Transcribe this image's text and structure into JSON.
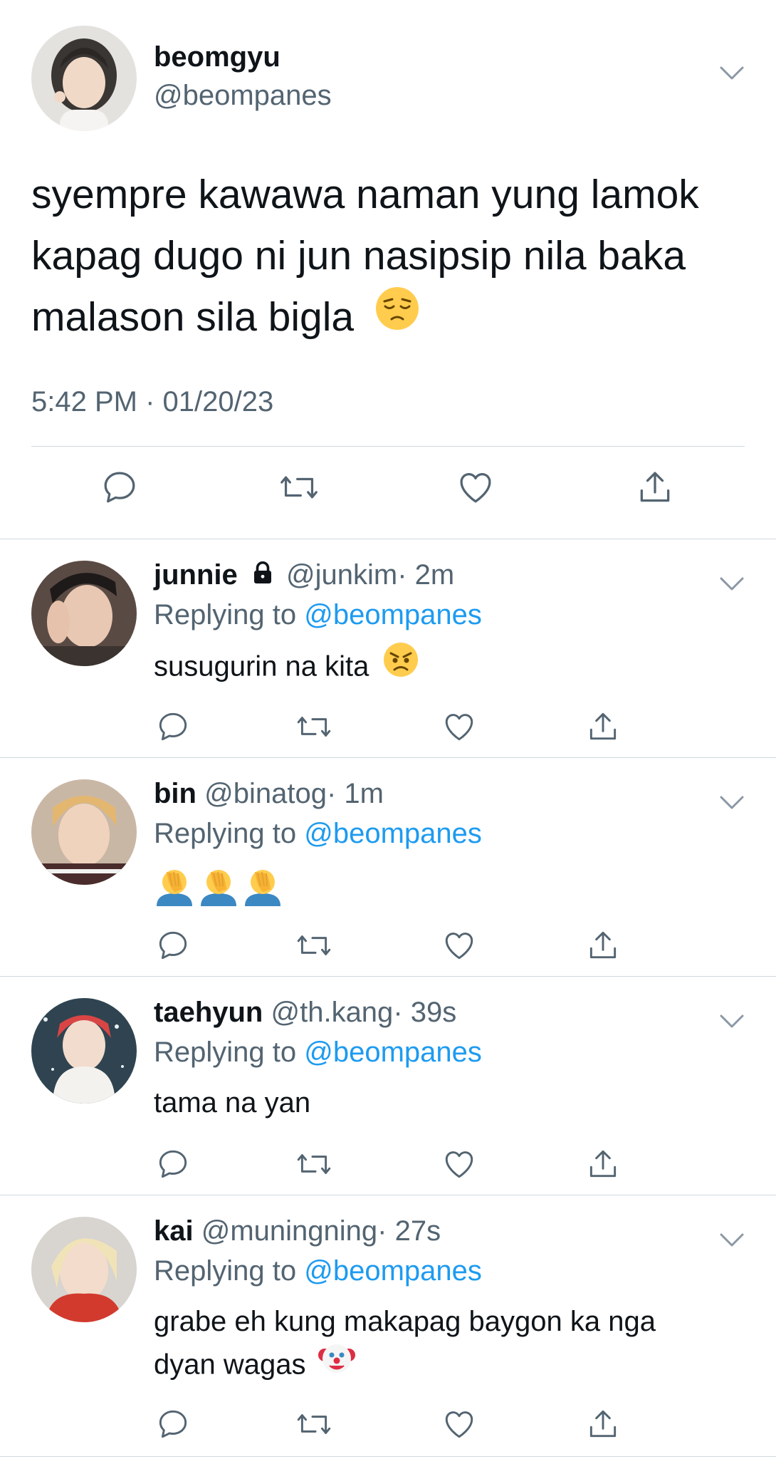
{
  "main_tweet": {
    "name": "beomgyu",
    "handle": "@beompanes",
    "text_line1": "syempre kawawa naman yung lamok",
    "text_line2": "kapag dugo ni jun nasipsip nila baka",
    "text_line3": "malason sila bigla",
    "timestamp": "5:42 PM · 01/20/23"
  },
  "replying_prefix": "Replying to",
  "replies": [
    {
      "name": "junnie",
      "handle": "@junkim",
      "time": "· 2m",
      "replying_to": "@beompanes",
      "text": "susugurin na kita"
    },
    {
      "name": "bin",
      "handle": "@binatog",
      "time": "· 1m",
      "replying_to": "@beompanes",
      "text": ""
    },
    {
      "name": "taehyun",
      "handle": "@th.kang",
      "time": "· 39s",
      "replying_to": "@beompanes",
      "text": "tama na yan"
    },
    {
      "name": "kai",
      "handle": "@muningning",
      "time": "· 27s",
      "replying_to": "@beompanes",
      "text_line1": "grabe eh kung makapag baygon ka nga",
      "text_line2": "dyan wagas"
    }
  ],
  "icons": {
    "reply": "reply-icon",
    "retweet": "retweet-icon",
    "like": "heart-icon",
    "share": "share-icon",
    "more": "chevron-down-icon",
    "lock": "lock-icon"
  },
  "colors": {
    "text": "#0f1419",
    "secondary": "#536471",
    "mention": "#1d9bf0",
    "divider": "#cfd9de"
  }
}
